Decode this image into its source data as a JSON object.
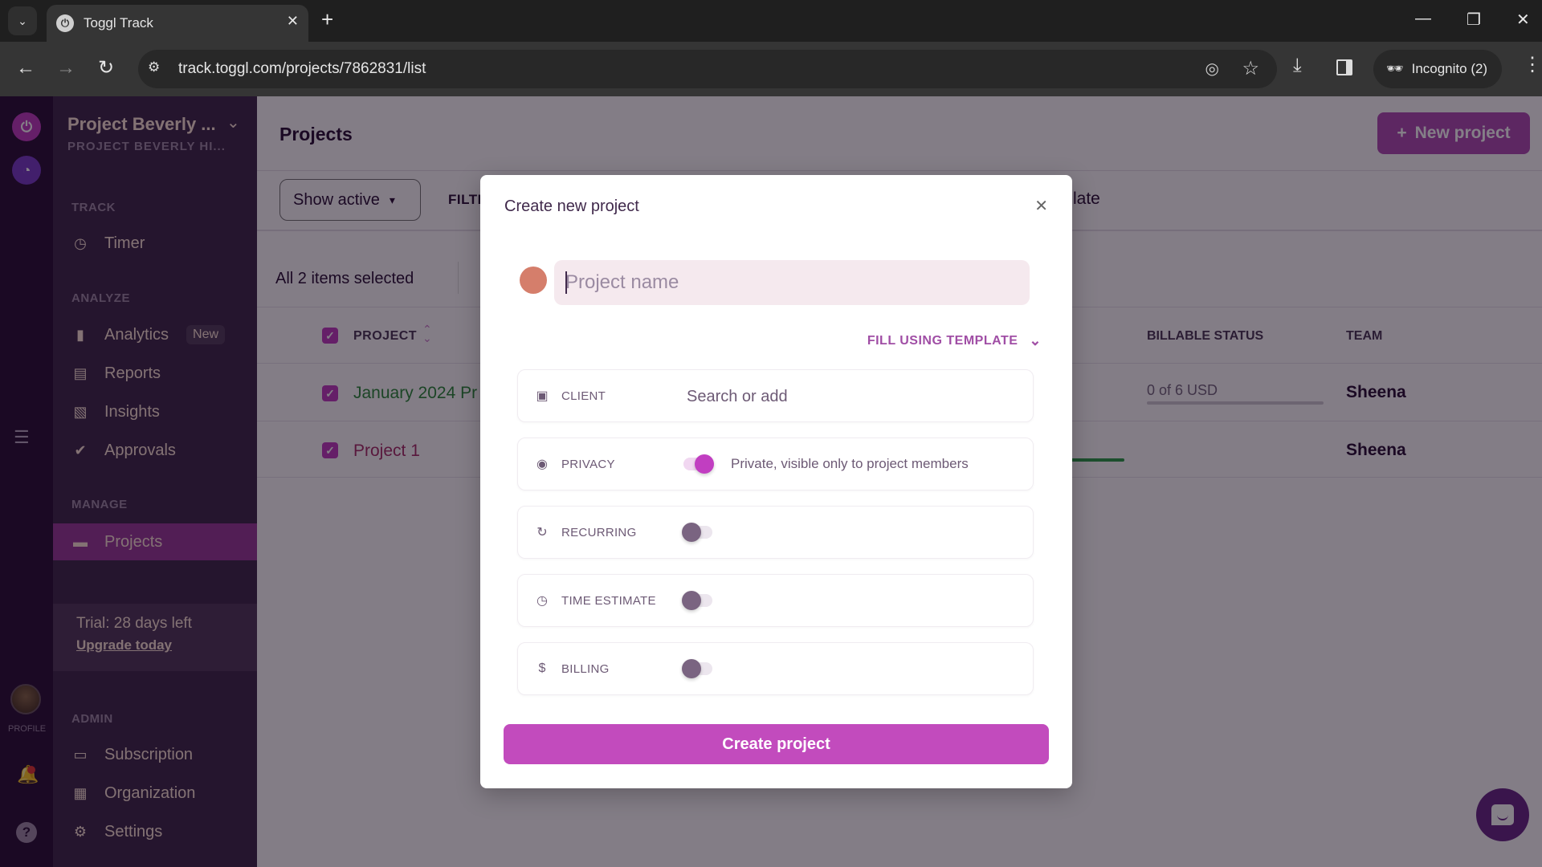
{
  "browser": {
    "tab_title": "Toggl Track",
    "url": "track.toggl.com/projects/7862831/list",
    "incognito_label": "Incognito (2)"
  },
  "sidebar": {
    "workspace_name": "Project Beverly ...",
    "workspace_sub": "PROJECT BEVERLY HI...",
    "sections": {
      "track": "TRACK",
      "analyze": "ANALYZE",
      "manage": "MANAGE",
      "admin": "ADMIN"
    },
    "items": [
      {
        "label": "Timer",
        "icon": "clock-icon"
      },
      {
        "label": "Analytics",
        "icon": "bar-chart-icon",
        "badge": "New"
      },
      {
        "label": "Reports",
        "icon": "report-icon"
      },
      {
        "label": "Insights",
        "icon": "insights-icon"
      },
      {
        "label": "Approvals",
        "icon": "check-circle-icon"
      },
      {
        "label": "Projects",
        "icon": "folder-icon",
        "active": true
      },
      {
        "label": "Subscription",
        "icon": "credit-card-icon"
      },
      {
        "label": "Organization",
        "icon": "building-icon"
      },
      {
        "label": "Settings",
        "icon": "gear-icon"
      }
    ],
    "trial_text": "Trial: 28 days left",
    "upgrade_label": "Upgrade today",
    "profile_label": "PROFILE"
  },
  "main": {
    "title": "Projects",
    "new_project_label": "New project",
    "show_active_label": "Show active",
    "filter_label": "FILTE",
    "template_partial": "late",
    "selection_text": "All 2 items selected",
    "columns": {
      "project": "PROJECT",
      "billable_status": "BILLABLE STATUS",
      "team": "TEAM"
    },
    "rows": [
      {
        "name": "January 2024 Pr",
        "billable": "0 of 6 USD",
        "billable_progress": 0,
        "team": "Sheena",
        "color": "#2e8b3d"
      },
      {
        "name": "Project 1",
        "billable": "",
        "team": "Sheena",
        "color": "#a8306a"
      }
    ]
  },
  "modal": {
    "title": "Create new project",
    "project_name_placeholder": "Project name",
    "project_name_value": "",
    "project_color": "#d57e6b",
    "fill_template_label": "FILL USING TEMPLATE",
    "fields": {
      "client": {
        "label": "CLIENT",
        "placeholder": "Search or add"
      },
      "privacy": {
        "label": "PRIVACY",
        "enabled": true,
        "description": "Private, visible only to project members"
      },
      "recurring": {
        "label": "RECURRING",
        "enabled": false
      },
      "time_estimate": {
        "label": "TIME ESTIMATE",
        "enabled": false
      },
      "billing": {
        "label": "BILLING",
        "enabled": false
      }
    },
    "create_label": "Create project"
  }
}
